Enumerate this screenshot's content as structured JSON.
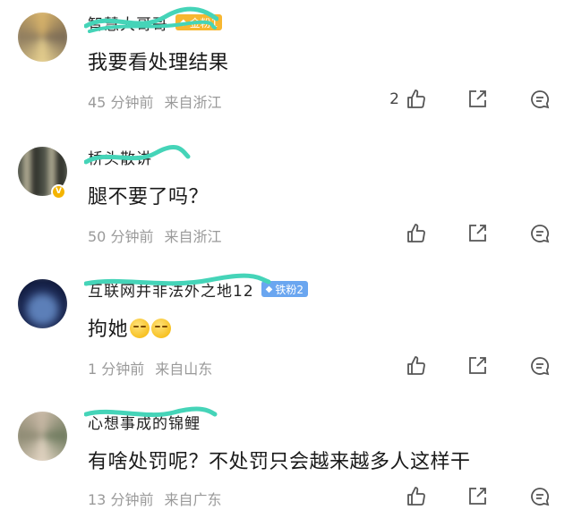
{
  "comments": [
    {
      "username": "智慧大哥哥",
      "badge": {
        "label": "金粉1",
        "color": "#f7b731",
        "icon": "diamond-icon"
      },
      "text": "我要看处理结果",
      "time": "45 分钟前",
      "location": "来自浙江",
      "likes": "2",
      "avatar_colors": [
        "#d8b36a",
        "#7a6a55"
      ]
    },
    {
      "username": "桥头散讲",
      "badge": null,
      "text": "腿不要了吗？",
      "time": "50 分钟前",
      "location": "来自浙江",
      "likes": "",
      "avatar_colors": [
        "#4b4f45",
        "#b9b49a"
      ]
    },
    {
      "username": "互联网并非法外之地12",
      "badge": {
        "label": "铁粉2",
        "color": "#6aa6f0",
        "icon": "diamond-icon"
      },
      "text": "拘她",
      "emojis": 2,
      "time": "1 分钟前",
      "location": "来自山东",
      "likes": "",
      "avatar_colors": [
        "#1c2a55",
        "#5c7fb8"
      ]
    },
    {
      "username": "心想事成的锦鲤",
      "badge": null,
      "text": "有啥处罚呢？不处罚只会越来越多人这样干",
      "time": "13 分钟前",
      "location": "来自广东",
      "likes": "",
      "avatar_colors": [
        "#6e7a5e",
        "#c9b9a6"
      ]
    }
  ],
  "icons": {
    "like": "thumbs-up-icon",
    "share": "share-icon",
    "reply": "comment-icon"
  },
  "colors": {
    "scribble": "#45d4b8",
    "meta_text": "#9a9a9a"
  }
}
